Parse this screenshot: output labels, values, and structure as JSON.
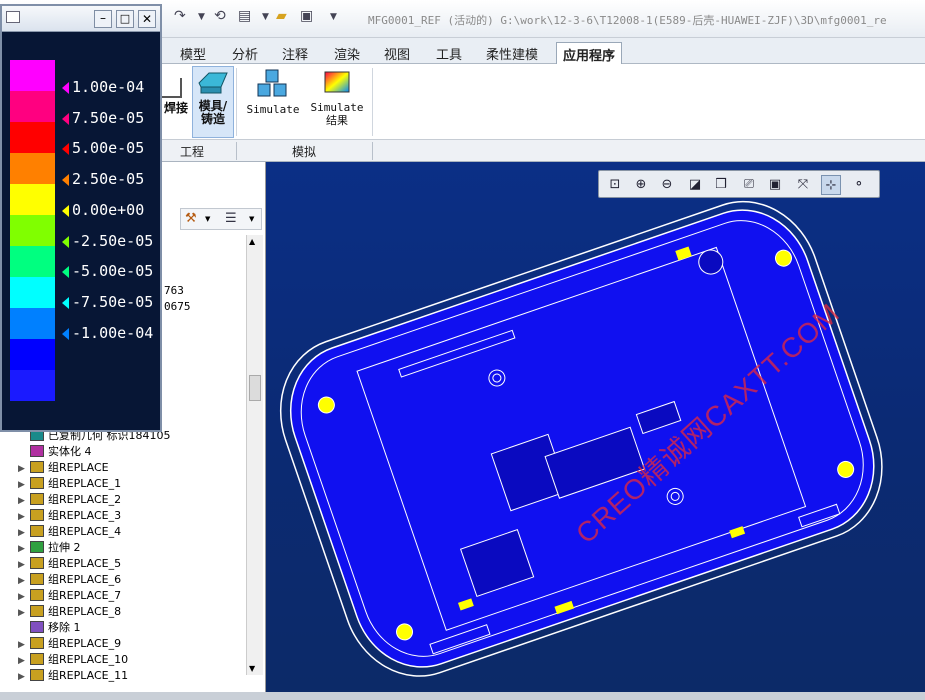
{
  "window": {
    "title": "MFG0001_REF (活动的) G:\\work\\12-3-6\\T12008-1(E589-后壳-HUAWEI-ZJF)\\3D\\mfg0001_re"
  },
  "tabs": [
    "模型",
    "分析",
    "注释",
    "渲染",
    "视图",
    "工具",
    "柔性建模",
    "应用程序"
  ],
  "active_tab": "应用程序",
  "ribbon": {
    "buttons": [
      {
        "label": "焊接",
        "icon": "weld-icon"
      },
      {
        "label": "模具/铸造",
        "icon": "mold-icon"
      },
      {
        "label": "Simulate",
        "icon": "simulate-icon"
      },
      {
        "label": "Simulate 结果",
        "icon": "simulate-results-icon"
      }
    ],
    "groups": [
      "工程",
      "模拟"
    ]
  },
  "legend": {
    "colors": [
      "#ff00ff",
      "#ff0080",
      "#ff0000",
      "#ff8000",
      "#ffff00",
      "#80ff00",
      "#00ff80",
      "#00ffff",
      "#0080ff",
      "#0000ff",
      "#1a1aff"
    ],
    "values": [
      "1.00e-04",
      "7.50e-05",
      "5.00e-05",
      "2.50e-05",
      "0.00e+00",
      "-2.50e-05",
      "-5.00e-05",
      "-7.50e-05",
      "-1.00e-04"
    ]
  },
  "tree_partial": [
    "763",
    "0675"
  ],
  "tree": [
    {
      "label": "已复制几何 标识184105",
      "expand": false,
      "icon": "copy-geom-icon"
    },
    {
      "label": "实体化 4",
      "expand": false,
      "icon": "solidify-icon"
    },
    {
      "label": "组REPLACE",
      "expand": true,
      "icon": "group-icon"
    },
    {
      "label": "组REPLACE_1",
      "expand": true,
      "icon": "group-icon"
    },
    {
      "label": "组REPLACE_2",
      "expand": true,
      "icon": "group-icon"
    },
    {
      "label": "组REPLACE_3",
      "expand": true,
      "icon": "group-icon"
    },
    {
      "label": "组REPLACE_4",
      "expand": true,
      "icon": "group-icon"
    },
    {
      "label": "拉伸 2",
      "expand": true,
      "icon": "extrude-icon"
    },
    {
      "label": "组REPLACE_5",
      "expand": true,
      "icon": "group-icon"
    },
    {
      "label": "组REPLACE_6",
      "expand": true,
      "icon": "group-icon"
    },
    {
      "label": "组REPLACE_7",
      "expand": true,
      "icon": "group-icon"
    },
    {
      "label": "组REPLACE_8",
      "expand": true,
      "icon": "group-icon"
    },
    {
      "label": "移除 1",
      "expand": false,
      "icon": "remove-icon"
    },
    {
      "label": "组REPLACE_9",
      "expand": true,
      "icon": "group-icon"
    },
    {
      "label": "组REPLACE_10",
      "expand": true,
      "icon": "group-icon"
    },
    {
      "label": "组REPLACE_11",
      "expand": true,
      "icon": "group-icon"
    }
  ],
  "view_toolbar": [
    "zoom-fit-icon",
    "zoom-in-icon",
    "zoom-out-icon",
    "repaint-icon",
    "saved-views-icon",
    "display-style-icon",
    "view-manager-icon",
    "perspective-icon",
    "datum-display-icon",
    "spin-center-icon",
    "annotation-display-icon"
  ],
  "watermark": "CREO精诚网CAXTT.COM",
  "colors": {
    "model_fill": "#1010f0",
    "model_edge": "#ffffff",
    "highlight": "#ffff00",
    "background": "#0b2a74"
  }
}
